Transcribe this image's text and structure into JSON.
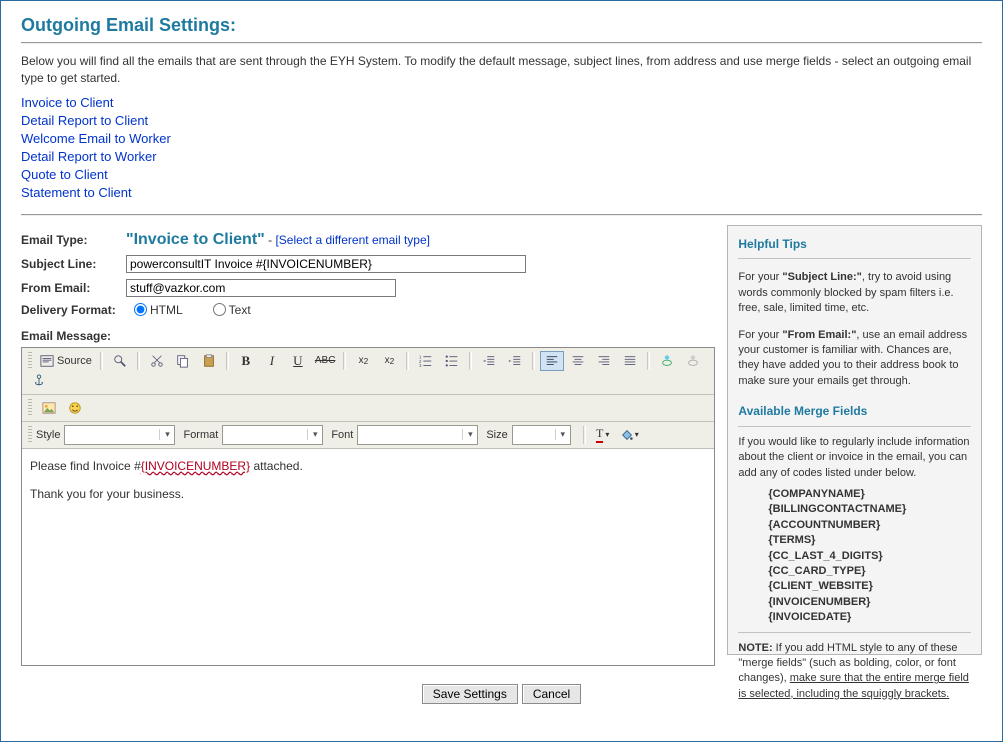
{
  "title": "Outgoing Email Settings:",
  "intro": "Below you will find all the emails that are sent through the EYH System. To modify the default message, subject lines, from address and use merge fields - select an outgoing email type to get started.",
  "email_types": [
    "Invoice to Client",
    "Detail Report to Client",
    "Welcome Email to Worker",
    "Detail Report to Worker",
    "Quote to Client",
    "Statement to Client"
  ],
  "labels": {
    "email_type": "Email Type:",
    "subject_line": "Subject Line:",
    "from_email": "From Email:",
    "delivery_format": "Delivery Format:",
    "email_message": "Email Message:"
  },
  "selected": {
    "type_display": "\"Invoice to Client\"",
    "select_different": "[Select a different email type]",
    "subject": "powerconsultIT Invoice #{INVOICENUMBER}",
    "from": "stuff@vazkor.com",
    "format_html": "HTML",
    "format_text": "Text",
    "format_selected": "html",
    "body_line1_pre": "Please find Invoice #",
    "body_line1_merge": "{INVOICENUMBER}",
    "body_line1_post": " attached.",
    "body_line2": "Thank you for your business."
  },
  "editor": {
    "source_label": "Source",
    "style_label": "Style",
    "format_label": "Format",
    "font_label": "Font",
    "size_label": "Size",
    "style_value": "",
    "format_value": "",
    "font_value": "",
    "size_value": ""
  },
  "tips": {
    "heading": "Helpful Tips",
    "p1_a": "For your ",
    "p1_b": "\"Subject Line:\"",
    "p1_c": ", try to avoid using words commonly blocked by spam filters i.e. free, sale, limited time, etc.",
    "p2_a": "For your ",
    "p2_b": "\"From Email:\"",
    "p2_c": ", use an email address your customer is familiar with. Chances are, they have added you to their address book to make sure your emails get through.",
    "merge_heading": "Available Merge Fields",
    "merge_intro": "If you would like to regularly include information about the client or invoice in the email, you can add any of codes listed under below.",
    "merge_fields": [
      "{COMPANYNAME}",
      "{BILLINGCONTACTNAME}",
      "{ACCOUNTNUMBER}",
      "{TERMS}",
      "{CC_LAST_4_DIGITS}",
      "{CC_CARD_TYPE}",
      "{CLIENT_WEBSITE}",
      "{INVOICENUMBER}",
      "{INVOICEDATE}"
    ],
    "note_label": "NOTE:",
    "note_a": " If you add HTML style to any of these \"merge fields\" (such as bolding, color, or font changes), ",
    "note_u": "make sure that the entire merge field is selected, including the squiggly brackets."
  },
  "buttons": {
    "save": "Save Settings",
    "cancel": "Cancel"
  }
}
